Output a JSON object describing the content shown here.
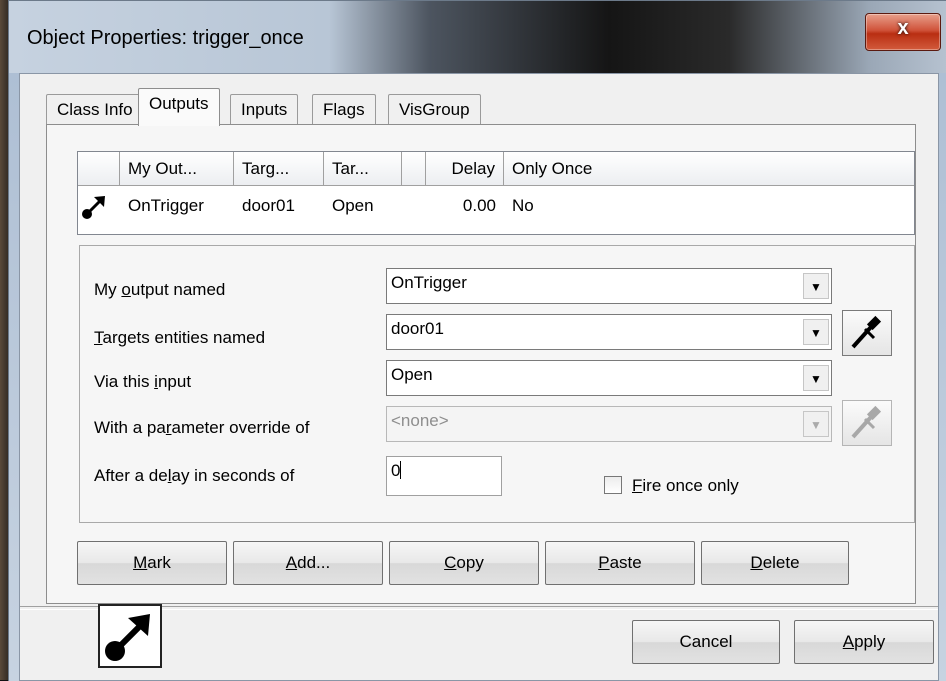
{
  "window": {
    "title": "Object Properties: trigger_once",
    "close_glyph": "x"
  },
  "tabs": [
    {
      "label": "Class Info"
    },
    {
      "label": "Outputs",
      "active": true
    },
    {
      "label": "Inputs"
    },
    {
      "label": "Flags"
    },
    {
      "label": "VisGroup"
    }
  ],
  "outputs_list": {
    "columns": [
      "",
      "My Out...",
      "Targ...",
      "Tar...",
      "",
      "Delay",
      "Only Once"
    ],
    "rows": [
      {
        "icon": "output-arrow-icon",
        "my_output": "OnTrigger",
        "target": "door01",
        "input": "Open",
        "delay": "0.00",
        "only_once": "No"
      }
    ]
  },
  "form": {
    "output_label_pre": "My ",
    "output_label_u": "o",
    "output_label_post": "utput named",
    "output_value": "OnTrigger",
    "targets_label_u": "T",
    "targets_label_post": "argets entities named",
    "targets_value": "door01",
    "input_label_pre": "Via this ",
    "input_label_u": "i",
    "input_label_post": "nput",
    "input_value": "Open",
    "param_label_pre": "With a pa",
    "param_label_u": "r",
    "param_label_post": "ameter override of",
    "param_value": "<none>",
    "delay_label_pre": "After a de",
    "delay_label_u": "l",
    "delay_label_post": "ay in seconds of",
    "delay_value": "0",
    "fire_once_label_u": "F",
    "fire_once_label_post": "ire once only",
    "fire_once_checked": false
  },
  "action_buttons": [
    {
      "u": "M",
      "rest": "ark"
    },
    {
      "u": "A",
      "rest": "dd..."
    },
    {
      "u": "C",
      "rest": "opy"
    },
    {
      "u": "P",
      "rest": "aste"
    },
    {
      "u": "D",
      "rest": "elete"
    }
  ],
  "footer": {
    "cancel_label": "Cancel",
    "apply_u": "A",
    "apply_rest": "pply",
    "entity_icon": "output-arrow-icon"
  }
}
